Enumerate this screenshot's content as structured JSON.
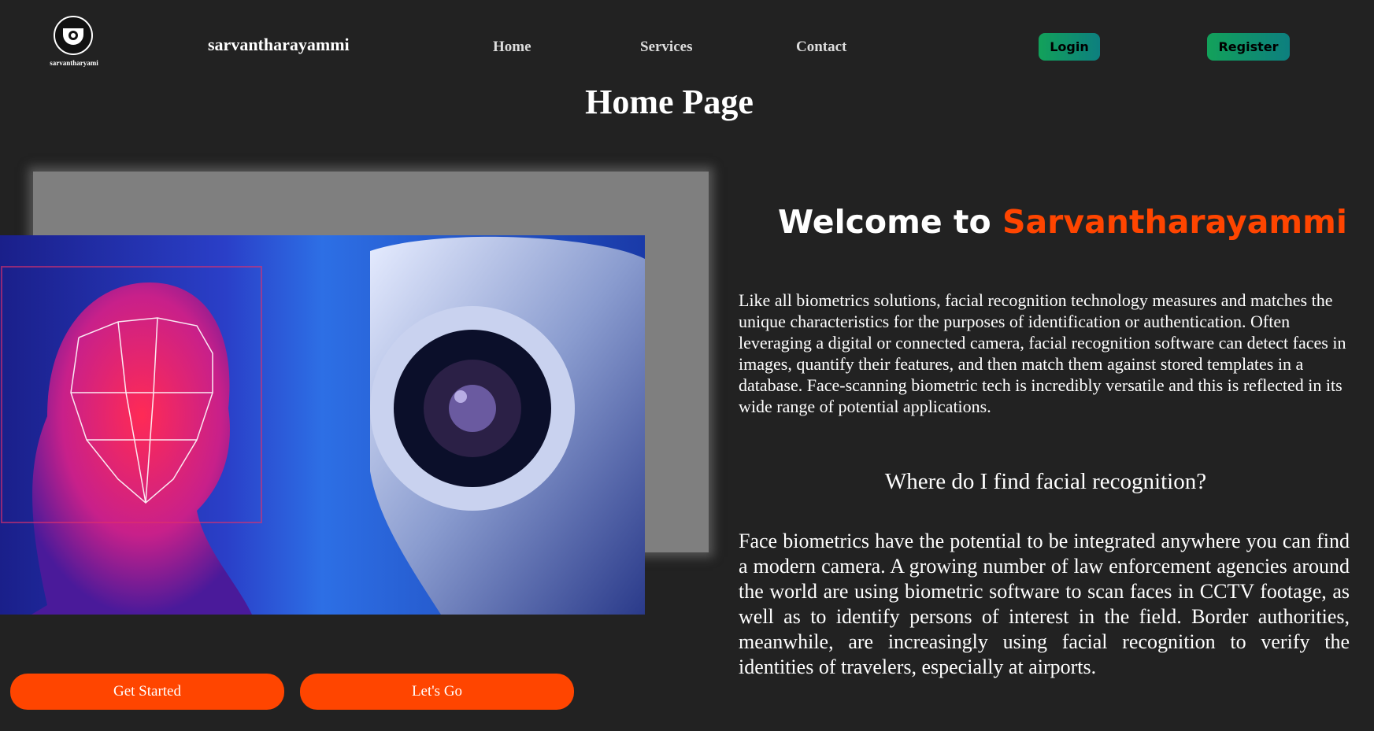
{
  "brand": {
    "logo_text": "sarvantharyami",
    "name": "sarvantharayammi"
  },
  "nav": {
    "links": [
      "Home",
      "Services",
      "Contact"
    ],
    "login_label": "Login",
    "register_label": "Register"
  },
  "page_title": "Home Page",
  "hero": {
    "primary_cta": "Get Started",
    "secondary_cta": "Let's Go"
  },
  "content": {
    "welcome_prefix": "Welcome to",
    "welcome_name": "Sarvantharayammi",
    "intro": "Like all biometrics solutions, facial recognition technology measures and matches the unique characteristics for the purposes of identification or authentication. Often leveraging a digital or connected camera, facial recognition software can detect faces in images, quantify their features, and then match them against stored templates in a database. Face-scanning biometric tech is incredibly versatile and this is reflected in its wide range of potential applications.",
    "subheading": "Where do I find facial recognition?",
    "body": "Face biometrics have the potential to be integrated anywhere you can find a modern camera. A growing number of law enforcement agencies around the world are using biometric software to scan faces in CCTV footage, as well as to identify persons of interest in the field. Border authorities, meanwhile, are increasingly using facial recognition to verify the identities of travelers, especially at airports."
  },
  "colors": {
    "background": "#222222",
    "accent": "#ff4500",
    "nav_button": "#12a15a"
  }
}
